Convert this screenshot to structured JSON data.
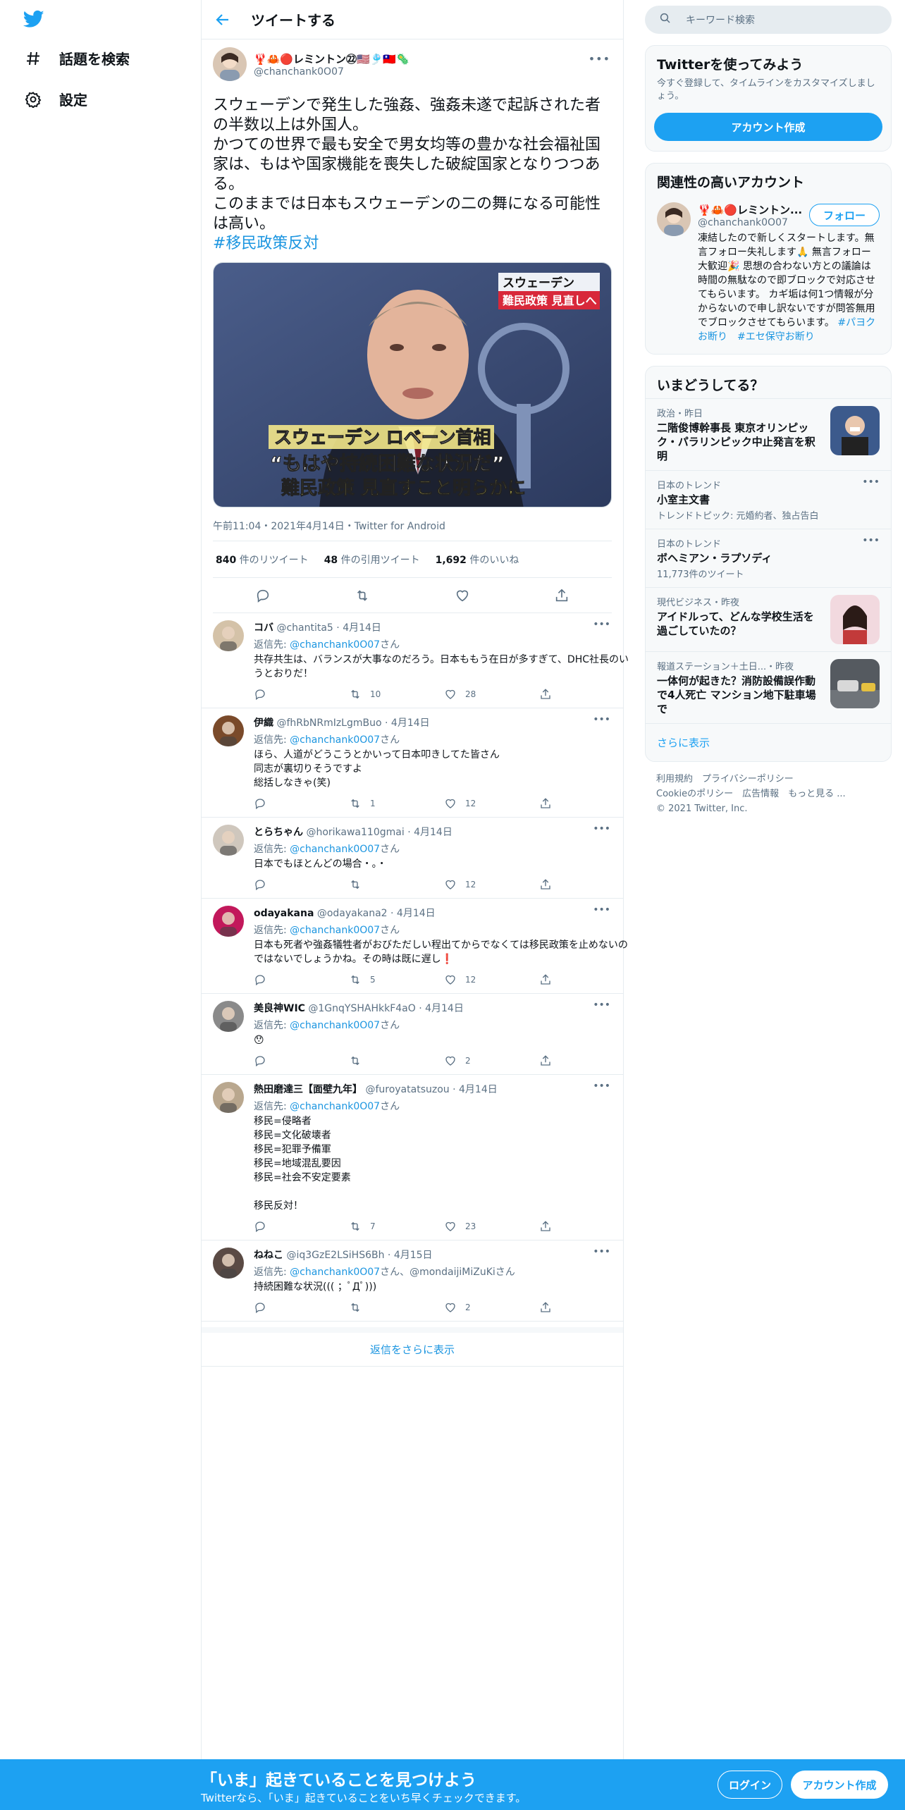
{
  "nav": {
    "explore": "話題を検索",
    "settings": "設定"
  },
  "header": {
    "title": "ツイートする"
  },
  "tweet": {
    "display_name": "🦞🦀🔴レミントン㉒🇺🇸🎐🇹🇼🦠",
    "handle": "@chanchank0O07",
    "text": "スウェーデンで発生した強姦、強姦未遂で起訴された者の半数以上は外国人。\nかつての世界で最も安全で男女均等の豊かな社会福祉国家は、もはや国家機能を喪失した破綻国家となりつつある。\nこのままでは日本もスウェーデンの二の舞になる可能性は高い。",
    "hashtag": "#移民政策反対",
    "media": {
      "caption_top": "スウェーデン",
      "caption_top2": "難民政策 見直しへ",
      "caption_name": "スウェーデン ロベーン首相",
      "caption_quote": "“もはや持続困難な状況だ”",
      "caption_bottom": "難民政策 見直すこと明らかに"
    },
    "meta": "午前11:04・2021年4月14日・Twitter for Android",
    "retweets": "840",
    "retweets_label": "件のリツイート",
    "quotes": "48",
    "quotes_label": "件の引用ツイート",
    "likes": "1,692",
    "likes_label": "件のいいね"
  },
  "replies": [
    {
      "name": "コバ",
      "handle": "@chantita5",
      "date": "4月14日",
      "to_prefix": "返信先: ",
      "to": "@chanchank0O07",
      "to_suffix": "さん",
      "text": "共存共生は、バランスが大事なのだろう。日本ももう在日が多すぎて、DHC社長のいうとおりだ！",
      "rt": "10",
      "likes": "28"
    },
    {
      "name": "伊織",
      "handle": "@fhRbNRmIzLgmBuo",
      "date": "4月14日",
      "to_prefix": "返信先: ",
      "to": "@chanchank0O07",
      "to_suffix": "さん",
      "text": "ほら、人道がどうこうとかいって日本叩きしてた皆さん\n同志が裏切りそうですよ\n総括しなきゃ(笑)",
      "rt": "1",
      "likes": "12"
    },
    {
      "name": "とらちゃん",
      "handle": "@horikawa110gmai",
      "date": "4月14日",
      "to_prefix": "返信先: ",
      "to": "@chanchank0O07",
      "to_suffix": "さん",
      "text": "日本でもほとんどの場合・。・",
      "rt": "",
      "likes": "12"
    },
    {
      "name": "odayakana",
      "handle": "@odayakana2",
      "date": "4月14日",
      "to_prefix": "返信先: ",
      "to": "@chanchank0O07",
      "to_suffix": "さん",
      "text": "日本も死者や強姦犠牲者がおびただしい程出てからでなくては移民政策を止めないのではないでしょうかね。その時は既に遅し❗",
      "rt": "5",
      "likes": "12"
    },
    {
      "name": "美良神WIC",
      "handle": "@1GnqYSHAHkkF4aO",
      "date": "4月14日",
      "to_prefix": "返信先: ",
      "to": "@chanchank0O07",
      "to_suffix": "さん",
      "text": "😯",
      "rt": "",
      "likes": "2"
    },
    {
      "name": "熱田磨達三【面壁九年】",
      "handle": "@furoyatatsuzou",
      "date": "4月14日",
      "to_prefix": "返信先: ",
      "to": "@chanchank0O07",
      "to_suffix": "さん",
      "text": "移民=侵略者\n移民=文化破壊者\n移民=犯罪予備軍\n移民=地域混乱要因\n移民=社会不安定要素\n\n移民反対！",
      "rt": "7",
      "likes": "23"
    },
    {
      "name": "ねねこ",
      "handle": "@iq3GzE2LSiHS6Bh",
      "date": "4月15日",
      "to_prefix": "返信先: ",
      "to": "@chanchank0O07",
      "to_suffix": "さん、@mondaijiMiZuKiさん",
      "text": "持続困難な状況((( ；ﾟДﾟ)))",
      "rt": "",
      "likes": "2"
    }
  ],
  "show_more_replies": "返信をさらに表示",
  "right": {
    "search_placeholder": "キーワード検索",
    "signup_card": {
      "title": "Twitterを使ってみよう",
      "sub": "今すぐ登録して、タイムラインをカスタマイズしましょう。",
      "button": "アカウント作成"
    },
    "related": {
      "title": "関連性の高いアカウント",
      "name": "🦞🦀🔴レミントン...",
      "handle": "@chanchank0O07",
      "follow": "フォロー",
      "bio": "凍結したので新しくスタートします。無言フォロー失礼します🙏 無言フォロー大歓迎🎉 思想の合わない方との議論は時間の無駄なので即ブロックで対応させてもらいます。 カギ垢は何1つ情報が分からないので申し訳ないですが問答無用でブロックさせてもらいます。",
      "bio_tags": "#パヨクお断り　#エセ保守お断り"
    },
    "trends": {
      "title": "いまどうしてる？",
      "items": [
        {
          "meta": "政治・昨日",
          "title": "二階俊博幹事長 東京オリンピック・パラリンピック中止発言を釈明",
          "sub": ""
        },
        {
          "meta": "日本のトレンド",
          "title": "小室主文書",
          "sub": "トレンドトピック: 元婚約者、独占告白"
        },
        {
          "meta": "日本のトレンド",
          "title": "ボヘミアン・ラプソディ",
          "sub": "11,773件のツイート"
        },
        {
          "meta": "現代ビジネス・昨夜",
          "title": "アイドルって、どんな学校生活を過ごしていたの？",
          "sub": ""
        },
        {
          "meta": "報道ステーション＋土日...・昨夜",
          "title": "一体何が起きた？消防設備誤作動で4人死亡 マンション地下駐車場で",
          "sub": ""
        }
      ],
      "more": "さらに表示"
    },
    "footer": {
      "line1": "利用規約　プライバシーポリシー",
      "line2": "Cookieのポリシー　広告情報　もっと見る ...",
      "line3": "© 2021 Twitter, Inc."
    }
  },
  "bottom_bar": {
    "title": "「いま」起きていることを見つけよう",
    "sub": "Twitterなら、「いま」起きていることをいち早くチェックできます。",
    "login": "ログイン",
    "signup": "アカウント作成"
  },
  "colors": {
    "accent": "#1da1f2",
    "link": "#1b95e0",
    "muted": "#5b7083"
  }
}
